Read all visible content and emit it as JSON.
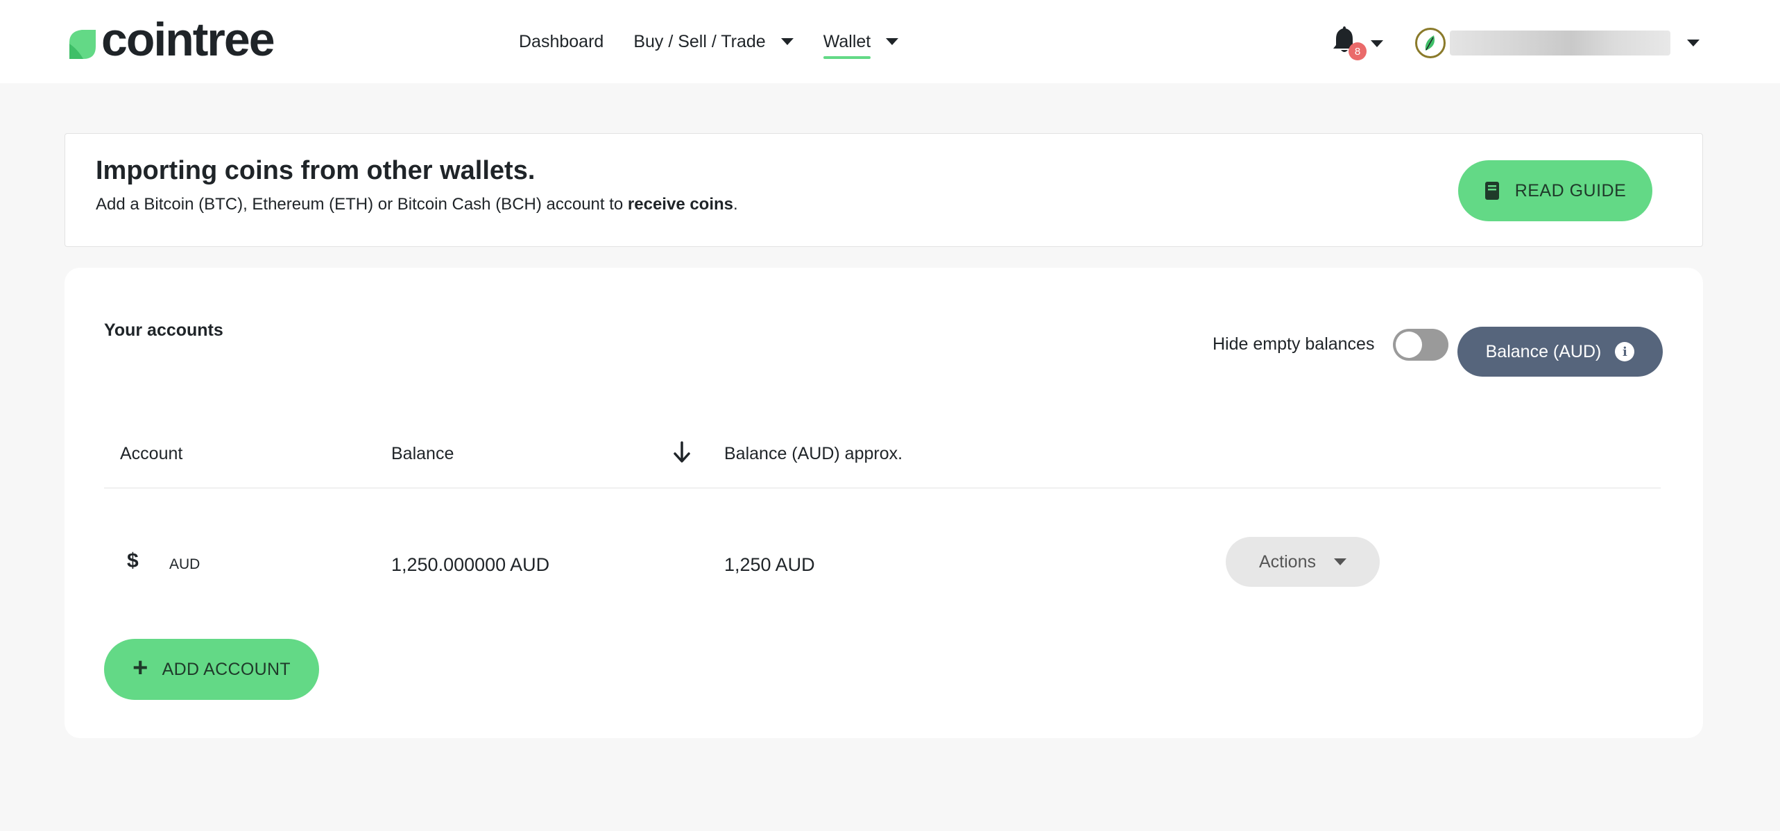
{
  "brand": {
    "name": "cointree",
    "accent": "#63d986",
    "slate": "#56657c"
  },
  "nav": {
    "items": [
      {
        "label": "Dashboard",
        "has_caret": false,
        "active": false
      },
      {
        "label": "Buy / Sell / Trade",
        "has_caret": true,
        "active": false
      },
      {
        "label": "Wallet",
        "has_caret": true,
        "active": true
      }
    ]
  },
  "notifications": {
    "count": "8",
    "icon": "bell-icon"
  },
  "user": {
    "avatar_icon": "leaf-icon",
    "name_blurred": true
  },
  "banner": {
    "title": "Importing coins from other wallets.",
    "text_before": "Add a Bitcoin (BTC), Ethereum (ETH) or Bitcoin Cash (BCH) account to ",
    "text_bold": "receive coins",
    "text_after": ".",
    "button_label": "READ GUIDE",
    "button_icon": "book-icon"
  },
  "accounts": {
    "title": "Your accounts",
    "hide_empty_label": "Hide empty balances",
    "hide_empty_enabled": false,
    "balance_button_label": "Balance (AUD)",
    "columns": [
      "Account",
      "Balance",
      "Balance (AUD) approx."
    ],
    "sort_icon": "arrow-down-icon",
    "rows": [
      {
        "icon": "dollar-icon",
        "icon_glyph": "$",
        "code": "AUD",
        "balance": "1,250.000000 AUD",
        "balance_aud": "1,250 AUD",
        "actions_label": "Actions"
      }
    ],
    "add_button_label": "ADD ACCOUNT"
  }
}
